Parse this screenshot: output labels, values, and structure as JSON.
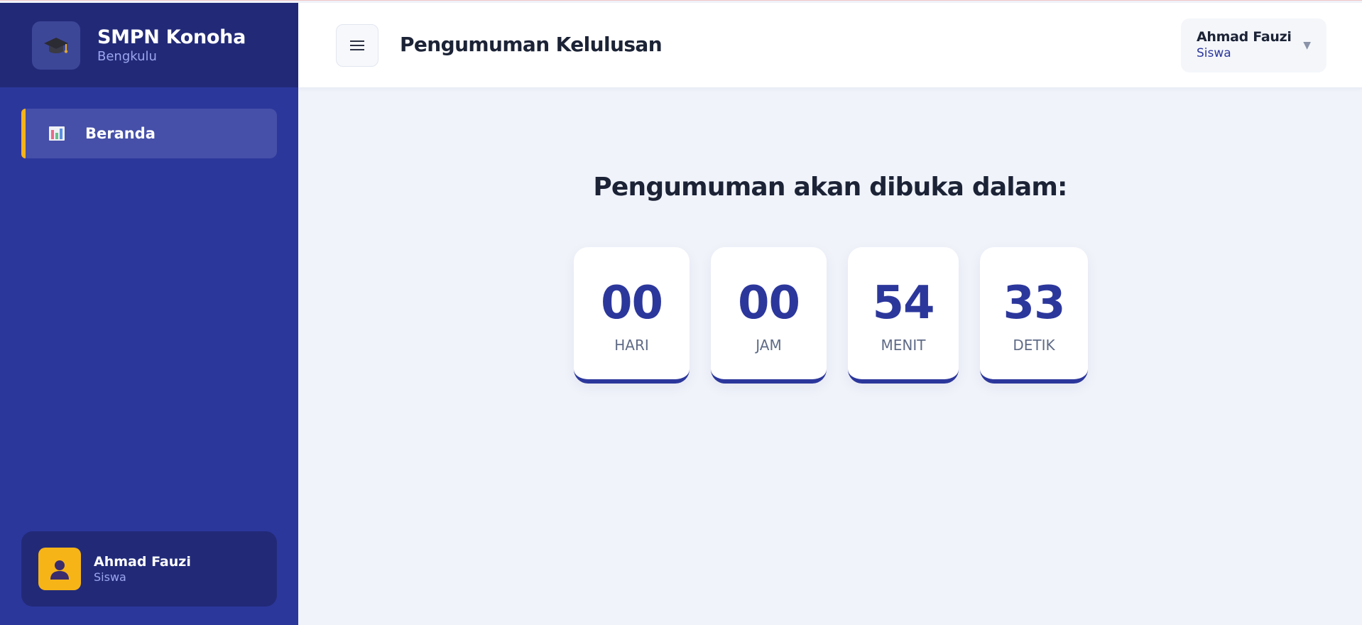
{
  "brand": {
    "name": "SMPN Konoha",
    "subtitle": "Bengkulu",
    "logo_icon": "graduation-cap-icon"
  },
  "sidebar": {
    "items": [
      {
        "label": "Beranda",
        "icon": "bar-chart-icon",
        "active": true
      }
    ],
    "user": {
      "name": "Ahmad Fauzi",
      "role": "Siswa",
      "avatar_icon": "person-silhouette-icon"
    }
  },
  "header": {
    "menu_icon": "hamburger-menu-icon",
    "title": "Pengumuman Kelulusan",
    "profile": {
      "name": "Ahmad Fauzi",
      "role": "Siswa",
      "caret": "▼"
    }
  },
  "countdown": {
    "title": "Pengumuman akan dibuka dalam:",
    "units": [
      {
        "value": "00",
        "label": "HARI"
      },
      {
        "value": "00",
        "label": "JAM"
      },
      {
        "value": "54",
        "label": "MENIT"
      },
      {
        "value": "33",
        "label": "DETIK"
      }
    ]
  },
  "colors": {
    "sidebar_bg": "#2c379c",
    "sidebar_header_bg": "#222a78",
    "accent": "#f4b41a",
    "primary": "#2c379c",
    "page_bg": "#f0f3fa"
  }
}
